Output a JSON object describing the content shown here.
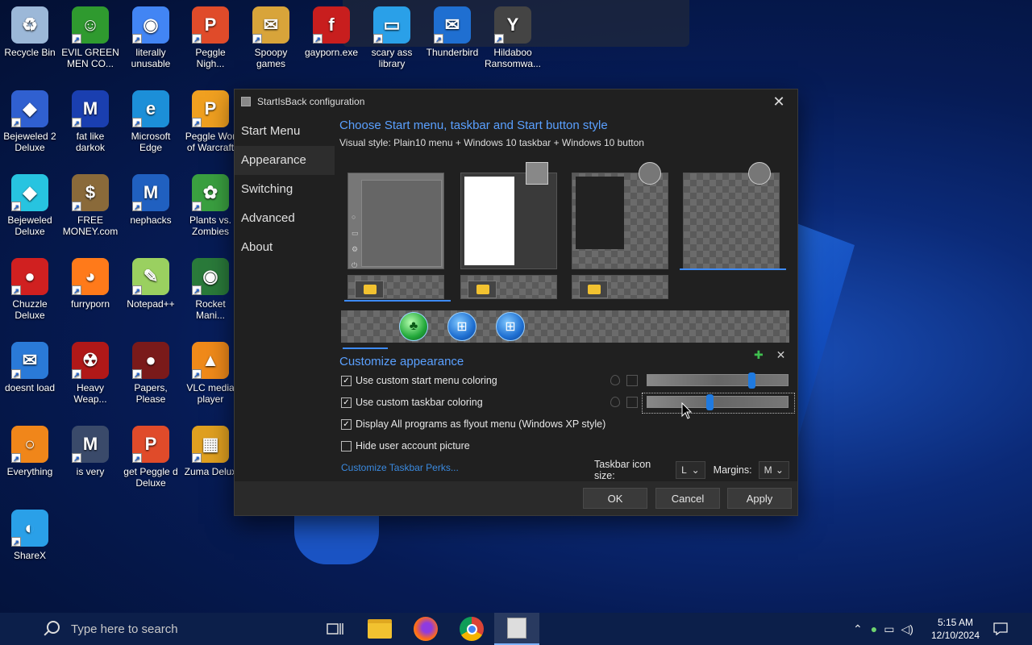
{
  "desktop": {
    "icons": [
      {
        "label": "Recycle Bin"
      },
      {
        "label": "EVIL GREEN MEN CO..."
      },
      {
        "label": "literally unusable"
      },
      {
        "label": "Peggle Nigh..."
      },
      {
        "label": "Spoopy games"
      },
      {
        "label": "gayporn.exe"
      },
      {
        "label": "scary ass library"
      },
      {
        "label": "Thunderbird"
      },
      {
        "label": "Hildaboo Ransomwa..."
      },
      {
        "label": "Bejeweled 2 Deluxe"
      },
      {
        "label": "fat like darkok"
      },
      {
        "label": "Microsoft Edge"
      },
      {
        "label": "Peggle Wor of Warcraft"
      },
      {
        "label": "Bejeweled Deluxe"
      },
      {
        "label": "FREE MONEY.com"
      },
      {
        "label": "nephacks"
      },
      {
        "label": "Plants vs. Zombies"
      },
      {
        "label": "Chuzzle Deluxe"
      },
      {
        "label": "furryporn"
      },
      {
        "label": "Notepad++"
      },
      {
        "label": "Rocket Mani..."
      },
      {
        "label": "doesnt load"
      },
      {
        "label": "Heavy Weap..."
      },
      {
        "label": "Papers, Please"
      },
      {
        "label": "VLC media player"
      },
      {
        "label": "Everything"
      },
      {
        "label": "is very"
      },
      {
        "label": "get Peggle d Deluxe"
      },
      {
        "label": "Zuma Delux"
      },
      {
        "label": "ShareX"
      }
    ]
  },
  "dialog": {
    "title": "StartIsBack configuration",
    "close_glyph": "✕",
    "nav": [
      "Start Menu",
      "Appearance",
      "Switching",
      "Advanced",
      "About"
    ],
    "section_title": "Choose Start menu, taskbar and Start button style",
    "visual_style": "Visual style:  Plain10 menu + Windows 10 taskbar + Windows 10 button",
    "customize_title": "Customize appearance",
    "checkboxes": [
      {
        "label": "Use custom start menu coloring",
        "checked": true
      },
      {
        "label": "Use custom taskbar coloring",
        "checked": true
      },
      {
        "label": "Display All programs as flyout menu (Windows XP style)",
        "checked": true
      },
      {
        "label": "Hide user account picture",
        "checked": false
      }
    ],
    "sliders": [
      {
        "level": 0.75
      },
      {
        "level": 0.44
      }
    ],
    "perks_link": "Customize Taskbar Perks...",
    "taskbar_icon_size_label": "Taskbar icon size:",
    "taskbar_icon_size_value": "L",
    "margins_label": "Margins:",
    "margins_value": "M",
    "buttons": {
      "ok": "OK",
      "cancel": "Cancel",
      "apply": "Apply"
    }
  },
  "taskbar": {
    "search_placeholder": "Type here to search",
    "time": "5:15 AM",
    "date": "12/10/2024"
  },
  "colors": {
    "accent": "#5aa0ff",
    "dialog_bg": "#202020",
    "taskbar_bg": "#0c1f4a"
  }
}
